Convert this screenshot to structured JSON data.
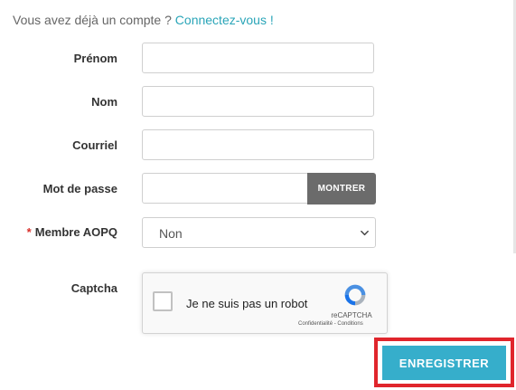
{
  "account_prompt": {
    "text": "Vous avez déjà un compte ?",
    "link": "Connectez-vous !"
  },
  "fields": {
    "first_name": {
      "label": "Prénom",
      "value": ""
    },
    "last_name": {
      "label": "Nom",
      "value": ""
    },
    "email": {
      "label": "Courriel",
      "value": ""
    },
    "password": {
      "label": "Mot de passe",
      "value": "",
      "show_label": "MONTRER"
    },
    "member": {
      "required_mark": "*",
      "label": "Membre AOPQ",
      "selected": "Non"
    },
    "captcha": {
      "label": "Captcha"
    }
  },
  "recaptcha": {
    "checkbox_text": "Je ne suis pas un robot",
    "brand": "reCAPTCHA",
    "terms": "Confidentialité - Conditions"
  },
  "submit_label": "ENREGISTRER",
  "colors": {
    "link": "#2aa5b8",
    "submit": "#36aecb",
    "highlight_frame": "#e0252c",
    "show_button": "#6b6b6b",
    "required": "#d9302b"
  }
}
